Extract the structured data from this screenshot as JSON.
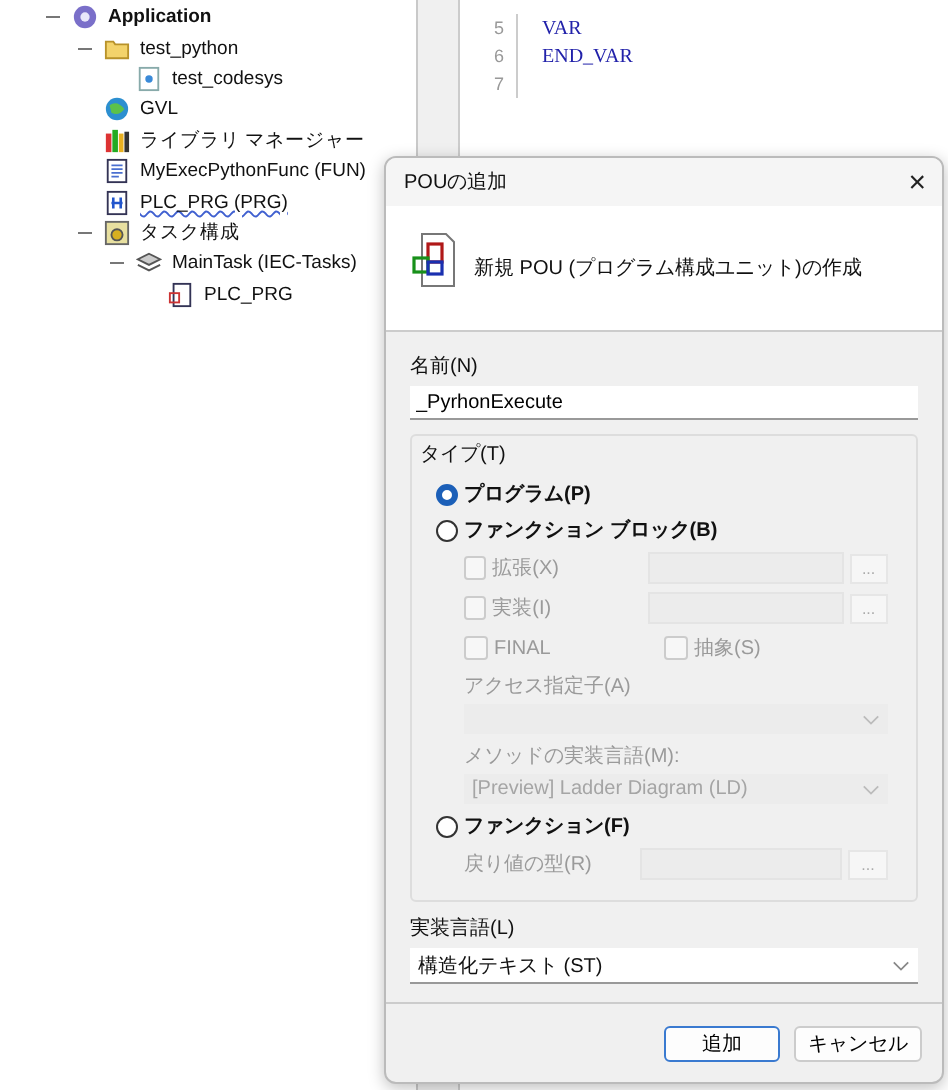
{
  "tree": [
    {
      "label": "Application",
      "kind": "app",
      "bold": true,
      "expanded": true,
      "children": [
        {
          "label": "test_python",
          "kind": "folder",
          "expanded": true,
          "children": [
            {
              "label": "test_codesys",
              "kind": "file"
            }
          ]
        },
        {
          "label": "GVL",
          "kind": "gvl"
        },
        {
          "label": "ライブラリ マネージャー",
          "kind": "library"
        },
        {
          "label": "MyExecPythonFunc (FUN)",
          "kind": "function"
        },
        {
          "label": "PLC_PRG (PRG)",
          "kind": "program",
          "spell_marked": true
        },
        {
          "label": "タスク構成",
          "kind": "taskconfig",
          "expanded": true,
          "children": [
            {
              "label": "MainTask (IEC-Tasks)",
              "kind": "task",
              "expanded": true,
              "children": [
                {
                  "label": "PLC_PRG",
                  "kind": "programref"
                }
              ]
            }
          ]
        }
      ]
    }
  ],
  "editor": {
    "lines": [
      {
        "number": "5",
        "code": "VAR"
      },
      {
        "number": "6",
        "code": "END_VAR"
      },
      {
        "number": "7"
      }
    ]
  },
  "dialog": {
    "title": "POUの追加",
    "close": "×",
    "heading": "新規 POU (プログラム構成ユニット)の作成",
    "name_label": "名前(N)",
    "name_value": "_PyrhonExecute",
    "type_label": "タイプ(T)",
    "types": [
      {
        "label": "プログラム(P)",
        "selected": true
      },
      {
        "label": "ファンクション ブロック(B)",
        "selected": false,
        "options": [
          {
            "kind": "picker",
            "label": "拡張(X)",
            "checked": false,
            "disabled": true,
            "browse": "..."
          },
          {
            "kind": "picker",
            "label": "実装(I)",
            "checked": false,
            "disabled": true,
            "browse": "..."
          },
          {
            "kind": "pair",
            "label": "FINAL",
            "checked": false,
            "disabled": true,
            "label2": "抽象(S)",
            "checked2": false
          },
          {
            "kind": "dropdown",
            "label": "アクセス指定子(A)",
            "disabled": true
          },
          {
            "kind": "dropdown",
            "label": "メソッドの実装言語(M):",
            "value": "[Preview] Ladder Diagram (LD)",
            "disabled": true
          }
        ]
      },
      {
        "label": "ファンクション(F)",
        "selected": false,
        "options": [
          {
            "kind": "text_picker",
            "label": "戻り値の型(R)",
            "disabled": true,
            "browse": "..."
          }
        ]
      }
    ],
    "language_label": "実装言語(L)",
    "language_value": "構造化テキスト (ST)",
    "buttons": [
      {
        "label": "追加",
        "default": true
      },
      {
        "label": "キャンセル",
        "default": false
      }
    ]
  }
}
